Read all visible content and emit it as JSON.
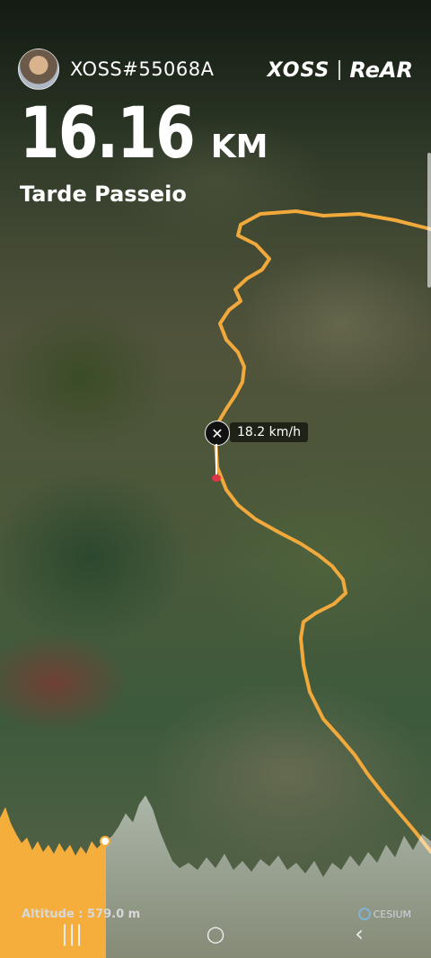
{
  "device_name": "XOSS#55068A",
  "brand": {
    "left": "XOSS",
    "right": "ReAR"
  },
  "distance": {
    "value": "16.16",
    "unit": "KM"
  },
  "ride_name": "Tarde Passeio",
  "speed_label": "18.2 km/h",
  "marker_icon": "✕",
  "altitude_label": "Altitude : 579.0 m",
  "attribution": "CESIUM",
  "route_color": "#f2a93b",
  "elevation_fill_past": "#f5ae3c",
  "icons": [
    "avatar",
    "close-icon",
    "cesium-logo",
    "recents-icon",
    "home-icon",
    "back-icon"
  ],
  "nav": {
    "recents": "|||",
    "home": "○",
    "back": "‹"
  }
}
